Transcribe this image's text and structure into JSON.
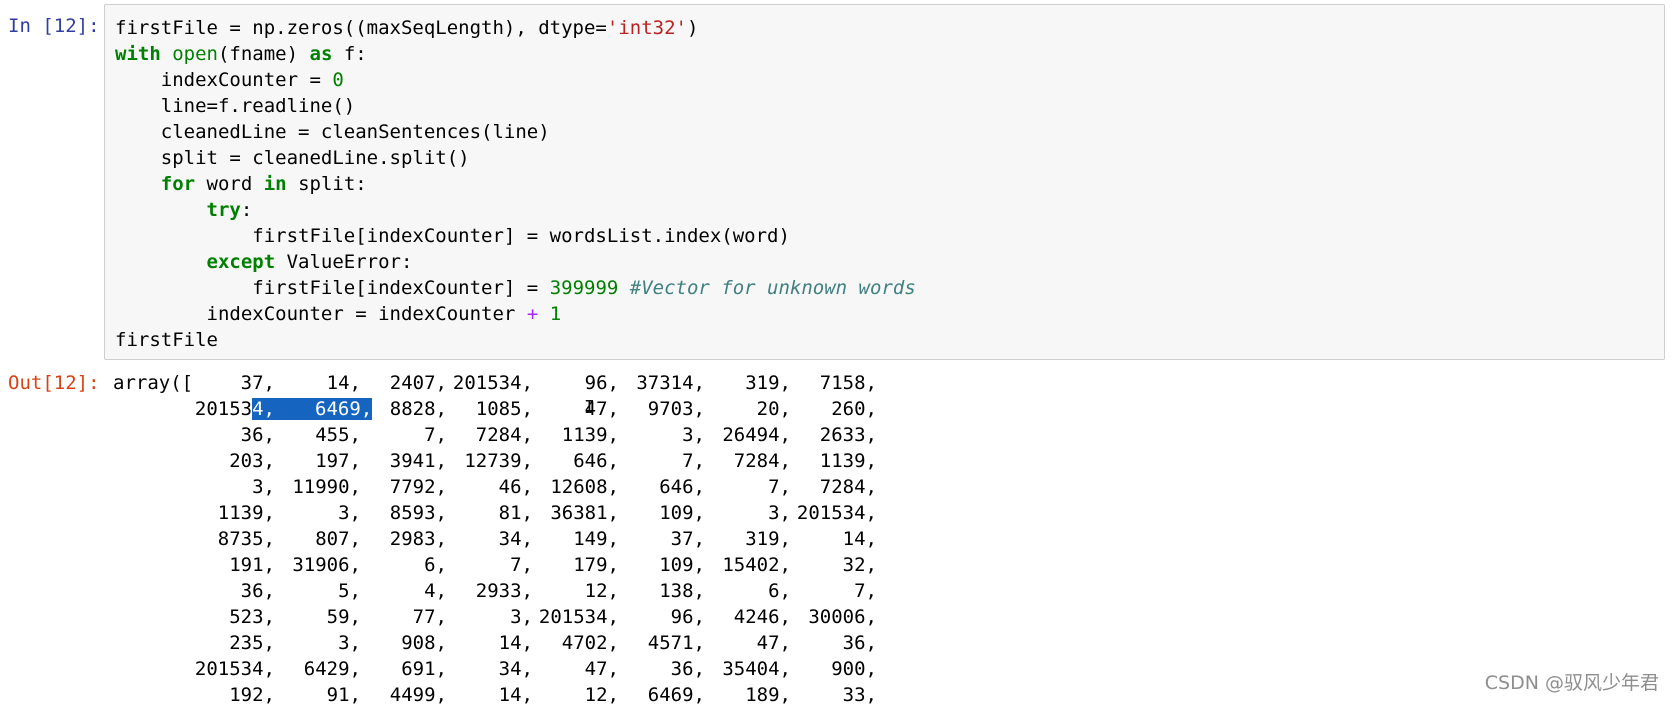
{
  "input_prompt": "In [12]:",
  "output_prompt": "Out[12]:",
  "code_lines": [
    [
      [
        "",
        "firstFile = np.zeros((maxSeqLength), dtype="
      ],
      [
        "str",
        "'int32'"
      ],
      [
        "",
        ")"
      ]
    ],
    [
      [
        "kw",
        "with"
      ],
      [
        "",
        " "
      ],
      [
        "bi",
        "open"
      ],
      [
        "",
        "(fname) "
      ],
      [
        "kw",
        "as"
      ],
      [
        "",
        " f:"
      ]
    ],
    [
      [
        "",
        "    indexCounter = "
      ],
      [
        "num",
        "0"
      ]
    ],
    [
      [
        "",
        "    line=f.readline()"
      ]
    ],
    [
      [
        "",
        "    cleanedLine = cleanSentences(line)"
      ]
    ],
    [
      [
        "",
        "    split = cleanedLine.split()"
      ]
    ],
    [
      [
        "",
        "    "
      ],
      [
        "kw",
        "for"
      ],
      [
        "",
        " word "
      ],
      [
        "kw",
        "in"
      ],
      [
        "",
        " split:"
      ]
    ],
    [
      [
        "",
        "        "
      ],
      [
        "kw",
        "try"
      ],
      [
        "",
        ":"
      ]
    ],
    [
      [
        "",
        "            firstFile[indexCounter] = wordsList.index(word)"
      ]
    ],
    [
      [
        "",
        "        "
      ],
      [
        "kw",
        "except"
      ],
      [
        "",
        " ValueError:"
      ]
    ],
    [
      [
        "",
        "            firstFile[indexCounter] = "
      ],
      [
        "num",
        "399999"
      ],
      [
        "",
        " "
      ],
      [
        "cm",
        "#Vector for unknown words"
      ]
    ],
    [
      [
        "",
        "        indexCounter = indexCounter "
      ],
      [
        "op",
        "+"
      ],
      [
        "",
        " "
      ],
      [
        "num",
        "1"
      ]
    ],
    [
      [
        "",
        "firstFile"
      ]
    ]
  ],
  "output": {
    "prefix": "array([",
    "rows": [
      [
        "37,",
        "14,",
        "2407,",
        "201534,",
        "96,",
        "37314,",
        "319,",
        "7158,"
      ],
      [
        "201534,",
        "6469,",
        "8828,",
        "1085,",
        "47,",
        "9703,",
        "20,",
        "260,"
      ],
      [
        "36,",
        "455,",
        "7,",
        "7284,",
        "1139,",
        "3,",
        "26494,",
        "2633,"
      ],
      [
        "203,",
        "197,",
        "3941,",
        "12739,",
        "646,",
        "7,",
        "7284,",
        "1139,"
      ],
      [
        "3,",
        "11990,",
        "7792,",
        "46,",
        "12608,",
        "646,",
        "7,",
        "7284,"
      ],
      [
        "1139,",
        "3,",
        "8593,",
        "81,",
        "36381,",
        "109,",
        "3,",
        "201534,"
      ],
      [
        "8735,",
        "807,",
        "2983,",
        "34,",
        "149,",
        "37,",
        "319,",
        "14,"
      ],
      [
        "191,",
        "31906,",
        "6,",
        "7,",
        "179,",
        "109,",
        "15402,",
        "32,"
      ],
      [
        "36,",
        "5,",
        "4,",
        "2933,",
        "12,",
        "138,",
        "6,",
        "7,"
      ],
      [
        "523,",
        "59,",
        "77,",
        "3,",
        "201534,",
        "96,",
        "4246,",
        "30006,"
      ],
      [
        "235,",
        "3,",
        "908,",
        "14,",
        "4702,",
        "4571,",
        "47,",
        "36,"
      ],
      [
        "201534,",
        "6429,",
        "691,",
        "34,",
        "47,",
        "36,",
        "35404,",
        "900,"
      ],
      [
        "192,",
        "91,",
        "4499,",
        "14,",
        "12,",
        "6469,",
        "189,",
        "33,"
      ]
    ]
  },
  "watermark": "CSDN @驭风少年君",
  "icons": {
    "text_cursor": "i-beam-cursor-icon"
  },
  "colors": {
    "keyword": "#008000",
    "string": "#ba2121",
    "comment": "#408080",
    "operator": "#aa22ff",
    "input_prompt": "#303f9f",
    "output_prompt": "#d84315",
    "selection": "#1565c0"
  }
}
